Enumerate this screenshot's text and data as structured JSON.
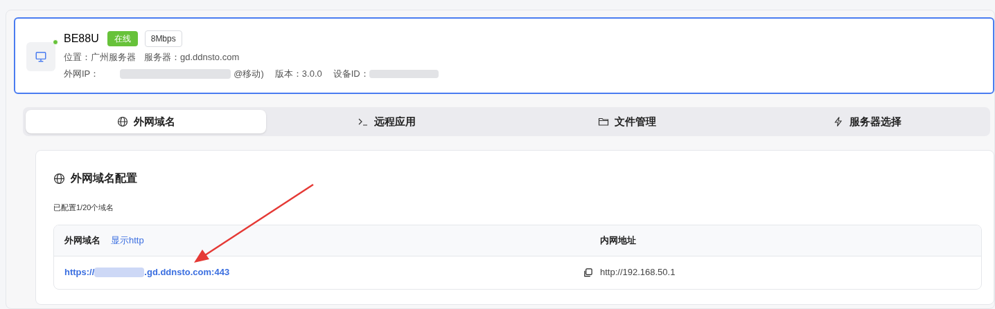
{
  "device": {
    "name": "BE88U",
    "online": true,
    "status": "在线",
    "speed": "8Mbps",
    "location_label": "位置：",
    "location": "广州服务器",
    "server_label": "服务器：",
    "server": "gd.ddnsto.com",
    "ip_label": "外网IP：",
    "ip_suffix": "@移动)",
    "version_label": "版本：",
    "version": "3.0.0",
    "device_id_label": "设备ID："
  },
  "tabs": [
    {
      "label": "外网域名",
      "kind": "globe",
      "selected": true
    },
    {
      "label": "远程应用",
      "kind": "terminal",
      "selected": false
    },
    {
      "label": "文件管理",
      "kind": "folder",
      "selected": false
    },
    {
      "label": "服务器选择",
      "kind": "bolt",
      "selected": false
    }
  ],
  "panel": {
    "title": "外网域名配置",
    "summary": "已配置1/20个域名",
    "table": {
      "columns": [
        {
          "label": "外网域名",
          "action": "显示http"
        },
        {
          "label": "内网地址"
        }
      ],
      "rows": [
        {
          "domain_prefix": "https://",
          "domain_suffix": ".gd.ddnsto.com:443",
          "internal": "http://192.168.50.1"
        }
      ]
    }
  }
}
